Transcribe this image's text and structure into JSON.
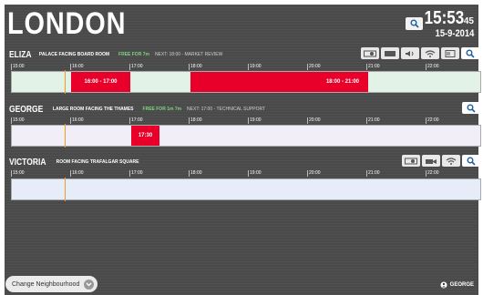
{
  "header": {
    "city": "LONDON",
    "time": "15:53",
    "seconds": "45",
    "date": "15-9-2014"
  },
  "timeline": {
    "ticks": [
      "15:00",
      "16:00",
      "17:00",
      "18:00",
      "19:00",
      "20:00",
      "21:00",
      "22:00"
    ]
  },
  "rooms": [
    {
      "name": "ELIZA",
      "desc": "PALACE FACING BOARD ROOM",
      "free": "FREE FOR 7m",
      "next": "NEXT: 18:00 - MARKET REVIEW",
      "events": [
        "16:00 - 17:00",
        "18:00 - 21:00"
      ]
    },
    {
      "name": "GEORGE",
      "desc": "LARGE ROOM FACING THE THAMES",
      "free": "FREE FOR 1m 7m",
      "next": "NEXT: 17:00 - TECHNICAL SUPPORT",
      "events": [
        "17:30"
      ]
    },
    {
      "name": "VICTORIA",
      "desc": "ROOM FACING TRAFALGAR SQUARE",
      "free": "",
      "next": "",
      "events": []
    }
  ],
  "footer": {
    "change_label": "Change Neighbourhood",
    "user": "GEORGE"
  },
  "colors": {
    "event": "#e8002a",
    "free": "#7fd47f",
    "now_line": "#f0a020"
  }
}
